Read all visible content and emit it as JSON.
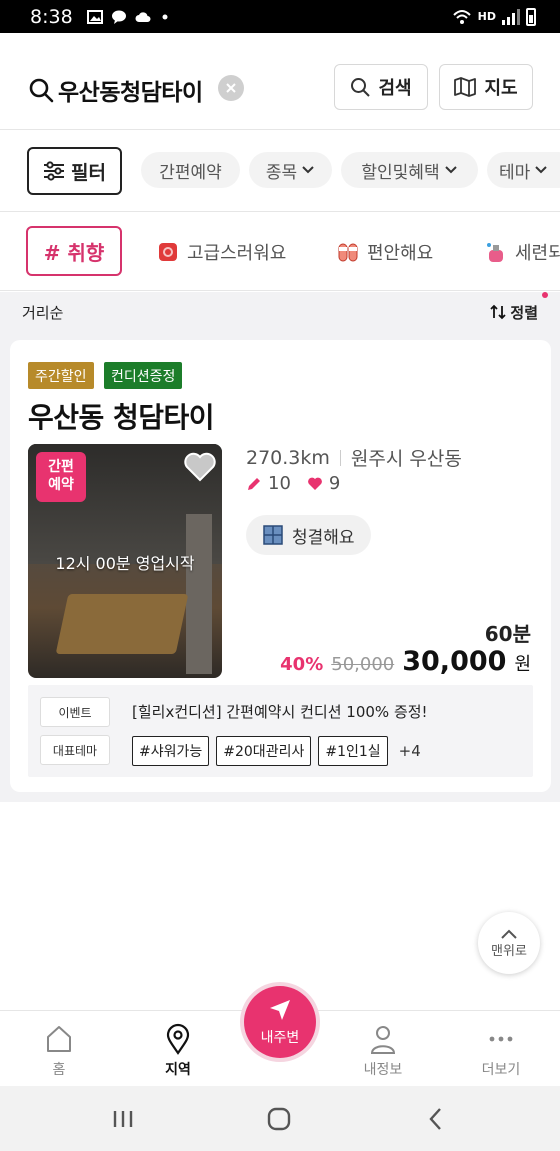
{
  "status_bar": {
    "time": "8:38",
    "net_label": "HD"
  },
  "search_header": {
    "query": "우산동청담타이",
    "search_label": "검색",
    "map_label": "지도"
  },
  "filter_row": {
    "filter_label": "필터",
    "chips": [
      "간편예약",
      "종목",
      "할인및혜택",
      "테마"
    ]
  },
  "taste_row": {
    "taste_label": "# 취향",
    "items": [
      "고급스러워요",
      "편안해요",
      "세련되"
    ]
  },
  "sort_bar": {
    "order": "거리순",
    "sort_label": "정렬"
  },
  "listing": {
    "tags": [
      "주간할인",
      "컨디션증정"
    ],
    "name": "우산동 청담타이",
    "booking_badge_line1": "간편",
    "booking_badge_line2": "예약",
    "open_time": "12시 00분 영업시작",
    "distance": "270.3km",
    "location": "원주시 우산동",
    "reviews": "10",
    "likes": "9",
    "amenity": "청결해요",
    "duration": "60분",
    "discount": "40%",
    "original_price": "50,000",
    "final_price": "30,000",
    "currency": "원",
    "event_label": "이벤트",
    "event_text": "[힐리x컨디션] 간편예약시 컨디션 100% 증정!",
    "theme_label": "대표테마",
    "themes": [
      "#샤워가능",
      "#20대관리사",
      "#1인1실"
    ],
    "themes_more": "+4"
  },
  "scroll_top_label": "맨위로",
  "bottom_nav": {
    "home": "홈",
    "region": "지역",
    "nearby": "내주변",
    "my_info": "내정보",
    "more": "더보기"
  },
  "colors": {
    "accent": "#e8336f",
    "weekly_tag": "#b78a2a",
    "condition_tag": "#1c7d2a"
  }
}
